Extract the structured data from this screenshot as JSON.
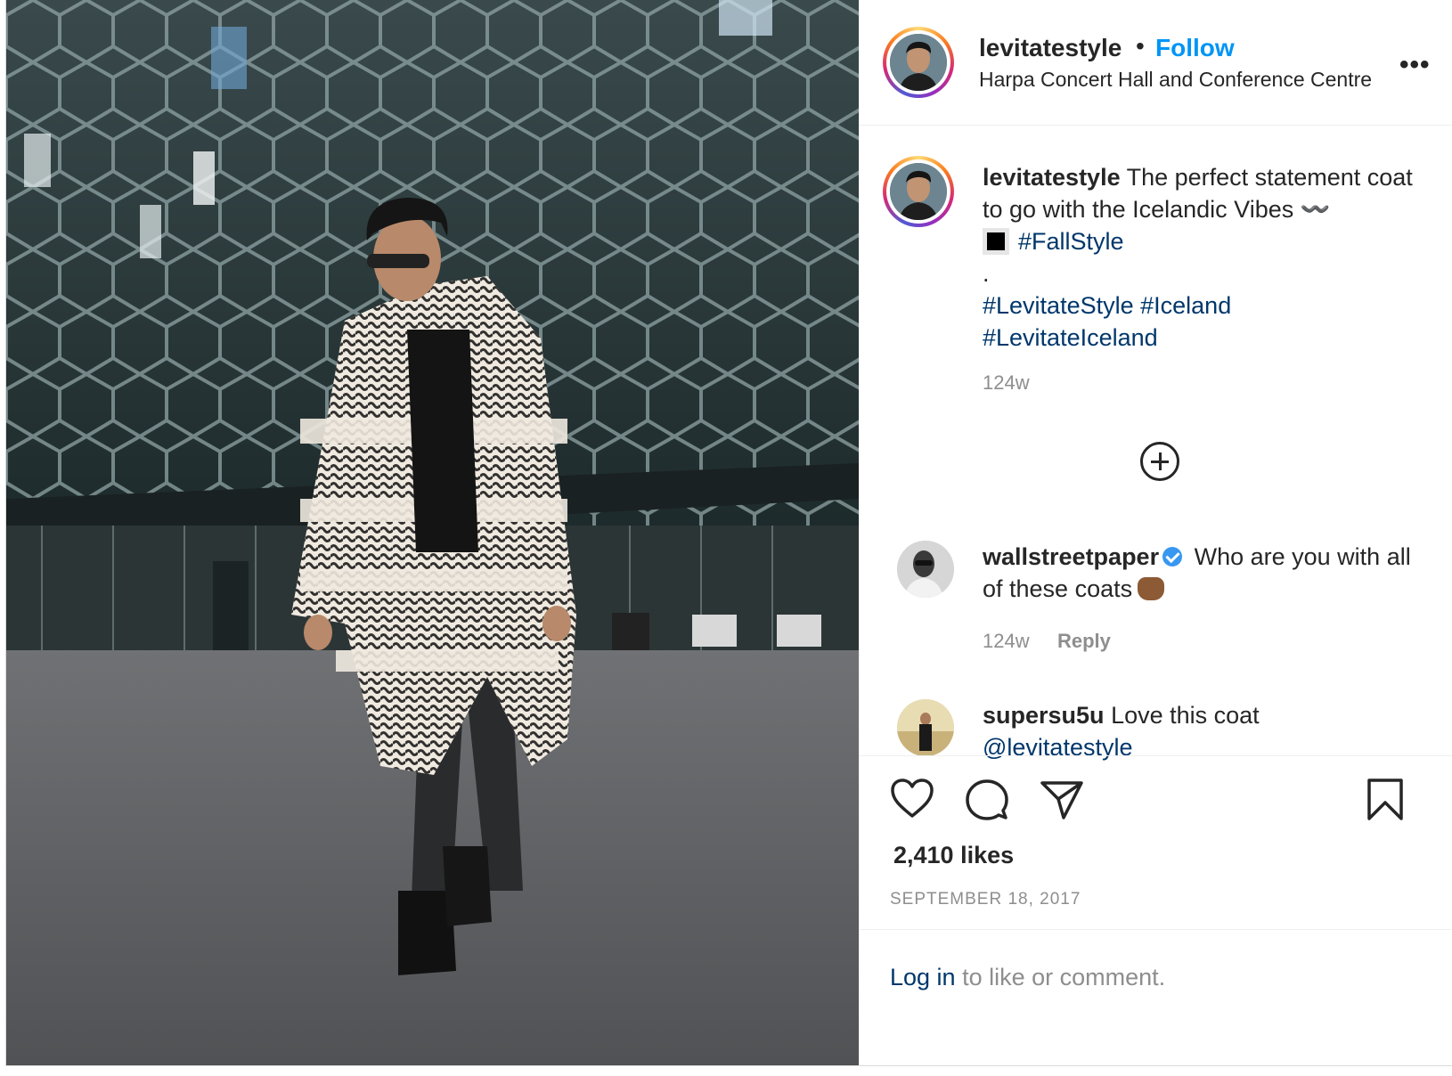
{
  "post": {
    "author": "levitatestyle",
    "separator": "•",
    "follow_label": "Follow",
    "location": "Harpa Concert Hall and Conference Centre",
    "more_label": "•••"
  },
  "caption": {
    "username": "levitatestyle",
    "text": "The perfect statement coat to go with the Icelandic Vibes 〰️",
    "hashtag_1": "#FallStyle",
    "dot": ".",
    "hashtag_2": "#LevitateStyle",
    "hashtag_3": "#Iceland",
    "hashtag_4": "#LevitateIceland",
    "time": "124w"
  },
  "comments": [
    {
      "username": "wallstreetpaper",
      "text": "Who are you with all of these coats",
      "time": "124w",
      "reply_label": "Reply"
    },
    {
      "username": "supersu5u",
      "text": "Love this coat",
      "mention": "@levitatestyle"
    }
  ],
  "stats": {
    "likes": "2,410 likes",
    "date": "SEPTEMBER 18, 2017"
  },
  "login": {
    "link": "Log in",
    "rest": " to like or comment."
  },
  "icons": {
    "like": "heart-icon",
    "comment": "comment-bubble-icon",
    "share": "paper-plane-icon",
    "save": "bookmark-icon",
    "load_more": "plus-circle-icon",
    "verified": "verified-badge-icon"
  },
  "colors": {
    "follow_blue": "#0095f6",
    "hashtag_blue": "#00376b",
    "muted_gray": "#8e8e8e",
    "text": "#262626"
  }
}
